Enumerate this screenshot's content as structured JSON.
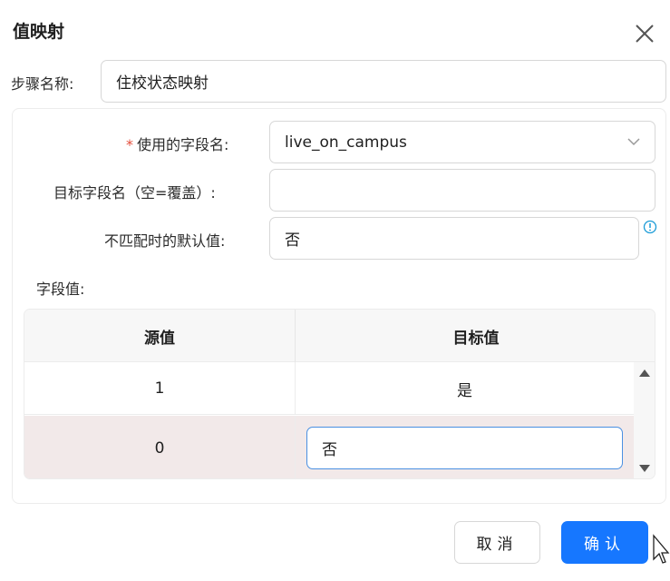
{
  "dialog": {
    "title": "值映射",
    "step_name_label": "步骤名称:",
    "step_name_value": "住校状态映射"
  },
  "form": {
    "required_mark": "*",
    "field_name_label": "使用的字段名:",
    "field_name_value": "live_on_campus",
    "target_field_label": "目标字段名（空=覆盖）:",
    "target_field_value": "",
    "default_value_label": "不匹配时的默认值:",
    "default_value": "否",
    "field_values_label": "字段值:"
  },
  "table": {
    "headers": [
      "源值",
      "目标值"
    ],
    "rows": [
      {
        "source": "1",
        "target": "是"
      },
      {
        "source": "0",
        "target": "否"
      }
    ]
  },
  "buttons": {
    "cancel": "取消",
    "ok": "确认"
  },
  "colors": {
    "primary": "#1677ff",
    "required": "#e34d3b",
    "selected_row": "#f2e9e9",
    "info": "#1a9bd7"
  },
  "icons": [
    "close-icon",
    "chevron-down-icon",
    "info-icon",
    "scroll-up-icon",
    "scroll-down-icon",
    "mouse-cursor-icon"
  ]
}
